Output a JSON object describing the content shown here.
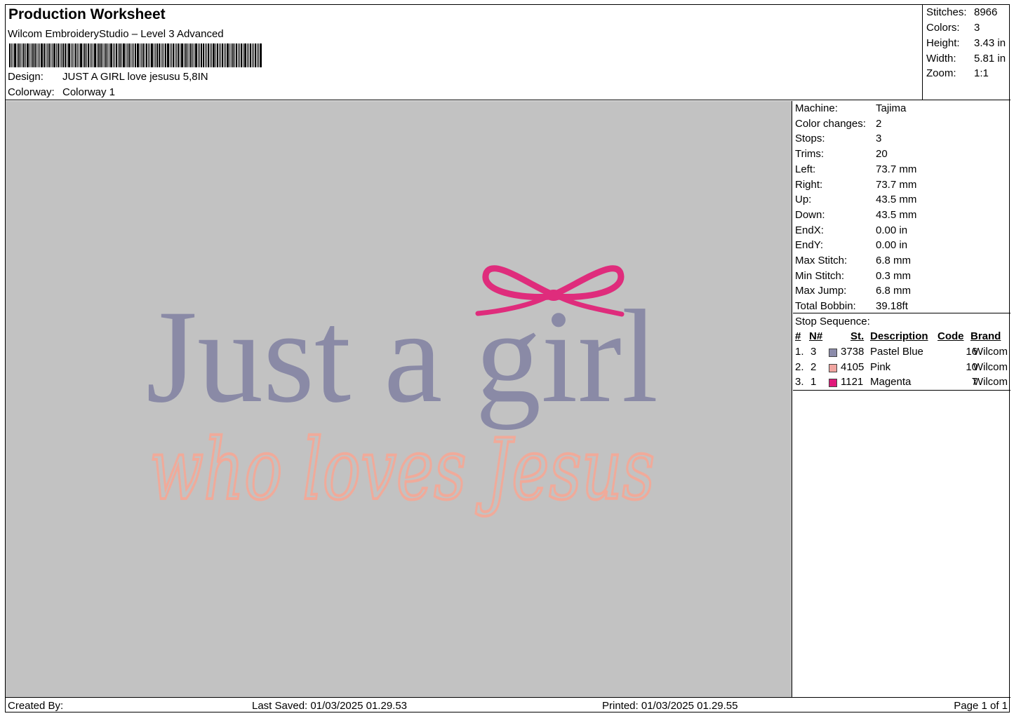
{
  "header": {
    "title": "Production Worksheet",
    "software": "Wilcom EmbroideryStudio – Level 3 Advanced",
    "design_label": "Design:",
    "design_value": "JUST A GIRL love jesusu 5,8IN",
    "colorway_label": "Colorway:",
    "colorway_value": "Colorway 1"
  },
  "stats": [
    {
      "label": "Stitches:",
      "value": "8966"
    },
    {
      "label": "Colors:",
      "value": "3"
    },
    {
      "label": "Height:",
      "value": "3.43 in"
    },
    {
      "label": "Width:",
      "value": "5.81 in"
    },
    {
      "label": "Zoom:",
      "value": "1:1"
    }
  ],
  "machine_info": [
    {
      "label": "Machine:",
      "value": "Tajima"
    },
    {
      "label": "Color changes:",
      "value": "2"
    },
    {
      "label": "Stops:",
      "value": "3"
    },
    {
      "label": "Trims:",
      "value": "20"
    },
    {
      "label": "Left:",
      "value": "73.7 mm"
    },
    {
      "label": "Right:",
      "value": "73.7 mm"
    },
    {
      "label": "Up:",
      "value": "43.5 mm"
    },
    {
      "label": "Down:",
      "value": "43.5 mm"
    },
    {
      "label": "EndX:",
      "value": "0.00 in"
    },
    {
      "label": "EndY:",
      "value": "0.00 in"
    },
    {
      "label": "Max Stitch:",
      "value": "6.8 mm"
    },
    {
      "label": "Min Stitch:",
      "value": "0.3 mm"
    },
    {
      "label": "Max Jump:",
      "value": "6.8 mm"
    },
    {
      "label": "Total Bobbin:",
      "value": "39.18ft"
    }
  ],
  "stop_sequence": {
    "title": "Stop Sequence:",
    "headers": {
      "num": "#",
      "n": "N#",
      "st": "St.",
      "description": "Description",
      "code": "Code",
      "brand": "Brand"
    },
    "rows": [
      {
        "num": "1.",
        "n": "3",
        "color": "#8c8cab",
        "st": "3738",
        "description": "Pastel Blue",
        "code": "16",
        "brand": "Wilcom"
      },
      {
        "num": "2.",
        "n": "2",
        "color": "#f0a5a0",
        "st": "4105",
        "description": "Pink",
        "code": "10",
        "brand": "Wilcom"
      },
      {
        "num": "3.",
        "n": "1",
        "color": "#e0187a",
        "st": "1121",
        "description": "Magenta",
        "code": "7",
        "brand": "Wilcom"
      }
    ]
  },
  "design": {
    "line1": "Just a girl",
    "line2": "who loves Jesus",
    "colors": {
      "line1": "#8a8aa6",
      "line2": "#f0aa9a",
      "bow": "#df2c7c",
      "background": "#c2c2c2"
    }
  },
  "footer": {
    "created_by": "Created By:",
    "last_saved": "Last Saved: 01/03/2025 01.29.53",
    "printed": "Printed: 01/03/2025 01.29.55",
    "page": "Page 1 of 1"
  }
}
